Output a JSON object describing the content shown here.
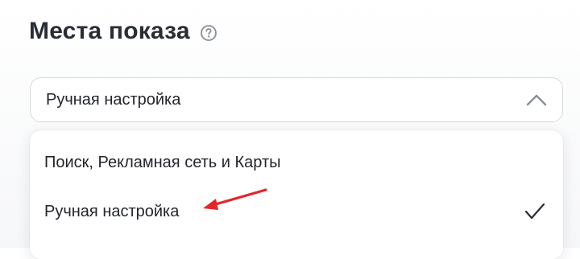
{
  "section": {
    "title": "Места показа",
    "help_icon": "question-circle-icon"
  },
  "select": {
    "value": "Ручная настройка",
    "expanded": true,
    "chevron_icon": "chevron-up-icon"
  },
  "dropdown": {
    "options": [
      {
        "label": "Поиск, Рекламная сеть и Карты",
        "selected": false
      },
      {
        "label": "Ручная настройка",
        "selected": true
      }
    ],
    "check_icon": "checkmark-icon"
  },
  "annotation": {
    "type": "red-arrow",
    "color": "#e3262a"
  },
  "colors": {
    "text": "#22252b",
    "title": "#2a2d35",
    "border": "#d6d9df",
    "icon": "#8a8f99",
    "accent_red": "#e3262a"
  }
}
